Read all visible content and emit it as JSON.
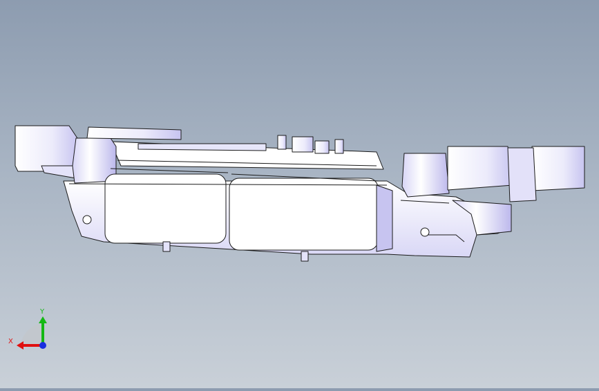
{
  "viewport": {
    "background_top": "#8d9cb0",
    "background_bottom": "#c9d0d8",
    "model_fill": "#ffffff",
    "model_shade": "#c9c6f2",
    "edge_color": "#1a1a1a"
  },
  "triad": {
    "x_label": "X",
    "y_label": "Y",
    "x_color": "#e01010",
    "y_color": "#14b814",
    "z_color": "#1a2fe0"
  }
}
